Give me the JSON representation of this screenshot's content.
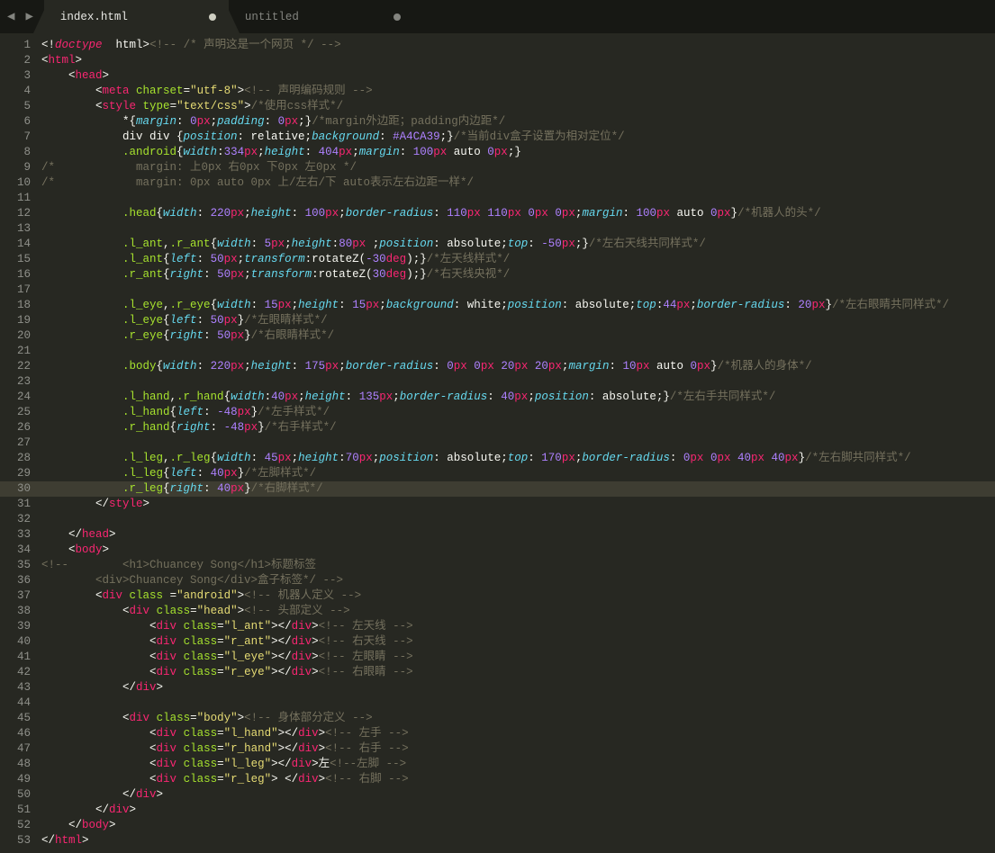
{
  "tabs": {
    "active": "index.html",
    "inactive": "untitled"
  },
  "gutter": [
    "1",
    "2",
    "3",
    "4",
    "5",
    "6",
    "7",
    "8",
    "9",
    "10",
    "11",
    "12",
    "13",
    "14",
    "15",
    "16",
    "17",
    "18",
    "19",
    "20",
    "21",
    "22",
    "23",
    "24",
    "25",
    "26",
    "27",
    "28",
    "29",
    "30",
    "31",
    "32",
    "33",
    "34",
    "35",
    "36",
    "37",
    "38",
    "39",
    "40",
    "41",
    "42",
    "43",
    "44",
    "45",
    "46",
    "47",
    "48",
    "49",
    "50",
    "51",
    "52",
    "53"
  ],
  "highlight_line_index": 29,
  "code": {
    "l1": {
      "a": "<!",
      "b": "doctype",
      "c": "  html",
      "d": ">",
      "e": "<!-- /* 声明这是一个网页 */ -->"
    },
    "l2": {
      "a": "<",
      "b": "html",
      "c": ">"
    },
    "l3": {
      "a": "    <",
      "b": "head",
      "c": ">"
    },
    "l4": {
      "a": "        <",
      "b": "meta",
      "c": " ",
      "d": "charset",
      "e": "=",
      "f": "\"utf-8\"",
      "g": ">",
      "h": "<!-- 声明编码规则 -->"
    },
    "l5": {
      "a": "        <",
      "b": "style",
      "c": " ",
      "d": "type",
      "e": "=",
      "f": "\"text/css\"",
      "g": ">",
      "h": "/*使用css样式*/"
    },
    "l6": {
      "a": "            *{",
      "b": "margin",
      "c": ": ",
      "d": "0",
      "e": "px",
      "f": ";",
      "g": "padding",
      "h": ": ",
      "i": "0",
      "j": "px",
      "k": ";}",
      "l": "/*margin外边距；padding内边距*/"
    },
    "l7": {
      "a": "            div div {",
      "b": "position",
      "c": ": relative;",
      "d": "background",
      "e": ": ",
      "f": "#A4CA39",
      "g": ";}",
      "h": "/*当前div盒子设置为相对定位*/"
    },
    "l8": {
      "a": "            ",
      "sel": ".android",
      "b": "{",
      "c": "width",
      "d": ":",
      "e": "334",
      "f": "px",
      "g": ";",
      "h": "height",
      "i": ": ",
      "j": "404",
      "k": "px",
      "l": ";",
      "m": "margin",
      "n": ": ",
      "o": "100",
      "p": "px",
      "q": " auto ",
      "r": "0",
      "s": "px",
      "t": ";}"
    },
    "l9": {
      "a": "/*            margin: 上0px 右0px 下0px 左0px */"
    },
    "l10": {
      "a": "/*            margin: 0px auto 0px 上/左右/下 auto表示左右边距一样*/"
    },
    "l11": "",
    "l12": {
      "a": "            ",
      "sel": ".head",
      "b": "{",
      "c": "width",
      "d": ": ",
      "e": "220",
      "f": "px",
      "g": ";",
      "h": "height",
      "i": ": ",
      "j": "100",
      "k": "px",
      "l": ";",
      "m": "border-radius",
      "n": ": ",
      "o": "110",
      "p": "px",
      "q": " ",
      "r": "110",
      "s": "px",
      "t": " ",
      "u": "0",
      "v": "px",
      "w": " ",
      "x": "0",
      "y": "px",
      "z": ";",
      "aa": "margin",
      "ab": ": ",
      "ac": "100",
      "ad": "px",
      "ae": " auto ",
      "af": "0",
      "ag": "px",
      "ah": "}",
      "ai": "/*机器人的头*/"
    },
    "l13": "",
    "l14": {
      "a": "            ",
      "sel": ".l_ant",
      "b": ",",
      "sel2": ".r_ant",
      "c": "{",
      "d": "width",
      "e": ": ",
      "f": "5",
      "g": "px",
      "h": ";",
      "i": "height",
      "j": ":",
      "k": "80",
      "l": "px",
      "m": " ;",
      "n": "position",
      "o": ": absolute;",
      "p": "top",
      "q": ": ",
      "r": "-50",
      "s": "px",
      "t": ";}",
      "u": "/*左右天线共同样式*/"
    },
    "l15": {
      "a": "            ",
      "sel": ".l_ant",
      "b": "{",
      "c": "left",
      "d": ": ",
      "e": "50",
      "f": "px",
      "g": ";",
      "h": "transform",
      "i": ":rotateZ(",
      "j": "-30",
      "k": "deg",
      "l": ");}",
      "m": "/*左天线样式*/"
    },
    "l16": {
      "a": "            ",
      "sel": ".r_ant",
      "b": "{",
      "c": "right",
      "d": ": ",
      "e": "50",
      "f": "px",
      "g": ";",
      "h": "transform",
      "i": ":rotateZ(",
      "j": "30",
      "k": "deg",
      "l": ");}",
      "m": "/*右天线央视*/"
    },
    "l17": "",
    "l18": {
      "a": "            ",
      "sel": ".l_eye",
      "b": ",",
      "sel2": ".r_eye",
      "c": "{",
      "d": "width",
      "e": ": ",
      "f": "15",
      "g": "px",
      "h": ";",
      "i": "height",
      "j": ": ",
      "k": "15",
      "l": "px",
      "m": ";",
      "n": "background",
      "o": ": white;",
      "p": "position",
      "q": ": absolute;",
      "r": "top",
      "s": ":",
      "t": "44",
      "u": "px",
      "v": ";",
      "w": "border-radius",
      "x": ": ",
      "y": "20",
      "z": "px",
      "aa": "}",
      "ab": "/*左右眼睛共同样式*/"
    },
    "l19": {
      "a": "            ",
      "sel": ".l_eye",
      "b": "{",
      "c": "left",
      "d": ": ",
      "e": "50",
      "f": "px",
      "g": "}",
      "h": "/*左眼睛样式*/"
    },
    "l20": {
      "a": "            ",
      "sel": ".r_eye",
      "b": "{",
      "c": "right",
      "d": ": ",
      "e": "50",
      "f": "px",
      "g": "}",
      "h": "/*右眼睛样式*/"
    },
    "l21": "",
    "l22": {
      "a": "            ",
      "sel": ".body",
      "b": "{",
      "c": "width",
      "d": ": ",
      "e": "220",
      "f": "px",
      "g": ";",
      "h": "height",
      "i": ": ",
      "j": "175",
      "k": "px",
      "l": ";",
      "m": "border-radius",
      "n": ": ",
      "o": "0",
      "p": "px",
      "q": " ",
      "r": "0",
      "s": "px",
      "t": " ",
      "u": "20",
      "v": "px",
      "w": " ",
      "x": "20",
      "y": "px",
      "z": ";",
      "aa": "margin",
      "ab": ": ",
      "ac": "10",
      "ad": "px",
      "ae": " auto ",
      "af": "0",
      "ag": "px",
      "ah": "}",
      "ai": "/*机器人的身体*/"
    },
    "l23": "",
    "l24": {
      "a": "            ",
      "sel": ".l_hand",
      "b": ",",
      "sel2": ".r_hand",
      "c": "{",
      "d": "width",
      "e": ":",
      "f": "40",
      "g": "px",
      "h": ";",
      "i": "height",
      "j": ": ",
      "k": "135",
      "l": "px",
      "m": ";",
      "n": "border-radius",
      "o": ": ",
      "p": "40",
      "q": "px",
      "r": ";",
      "s": "position",
      "t": ": absolute;}",
      "u": "/*左右手共同样式*/"
    },
    "l25": {
      "a": "            ",
      "sel": ".l_hand",
      "b": "{",
      "c": "left",
      "d": ": ",
      "e": "-48",
      "f": "px",
      "g": "}",
      "h": "/*左手样式*/"
    },
    "l26": {
      "a": "            ",
      "sel": ".r_hand",
      "b": "{",
      "c": "right",
      "d": ": ",
      "e": "-48",
      "f": "px",
      "g": "}",
      "h": "/*右手样式*/"
    },
    "l27": "",
    "l28": {
      "a": "            ",
      "sel": ".l_leg",
      "b": ",",
      "sel2": ".r_leg",
      "c": "{",
      "d": "width",
      "e": ": ",
      "f": "45",
      "g": "px",
      "h": ";",
      "i": "height",
      "j": ":",
      "k": "70",
      "l": "px",
      "m": ";",
      "n": "position",
      "o": ": absolute;",
      "p": "top",
      "q": ": ",
      "r": "170",
      "s": "px",
      "t": ";",
      "u": "border-radius",
      "v": ": ",
      "w": "0",
      "x": "px",
      "y": " ",
      "z": "0",
      "aa": "px",
      "ab": " ",
      "ac": "40",
      "ad": "px",
      "ae": " ",
      "af": "40",
      "ag": "px",
      "ah": "}",
      "ai": "/*左右脚共同样式*/"
    },
    "l29": {
      "a": "            ",
      "sel": ".l_leg",
      "b": "{",
      "c": "left",
      "d": ": ",
      "e": "40",
      "f": "px",
      "g": "}",
      "h": "/*左脚样式*/"
    },
    "l30": {
      "a": "            ",
      "sel": ".r_leg",
      "b": "{",
      "c": "right",
      "d": ": ",
      "e": "40",
      "f": "px",
      "g": "}",
      "h": "/*右脚样式*/"
    },
    "l31": {
      "a": "        </",
      "b": "style",
      "c": ">"
    },
    "l32": "",
    "l33": {
      "a": "    </",
      "b": "head",
      "c": ">"
    },
    "l34": {
      "a": "    <",
      "b": "body",
      "c": ">"
    },
    "l35": {
      "a": "<!--        <h1>Chuancey Song</h1>标题标签"
    },
    "l36": {
      "a": "        <div>Chuancey Song</div>盒子标签*/ -->"
    },
    "l37": {
      "a": "        <",
      "b": "div",
      "c": " ",
      "d": "class",
      "e": " =",
      "f": "\"android\"",
      "g": ">",
      "h": "<!-- 机器人定义 -->"
    },
    "l38": {
      "a": "            <",
      "b": "div",
      "c": " ",
      "d": "class",
      "e": "=",
      "f": "\"head\"",
      "g": ">",
      "h": "<!-- 头部定义 -->"
    },
    "l39": {
      "a": "                <",
      "b": "div",
      "c": " ",
      "d": "class",
      "e": "=",
      "f": "\"l_ant\"",
      "g": "></",
      "h": "div",
      "i": ">",
      "j": "<!-- 左天线 -->"
    },
    "l40": {
      "a": "                <",
      "b": "div",
      "c": " ",
      "d": "class",
      "e": "=",
      "f": "\"r_ant\"",
      "g": "></",
      "h": "div",
      "i": ">",
      "j": "<!-- 右天线 -->"
    },
    "l41": {
      "a": "                <",
      "b": "div",
      "c": " ",
      "d": "class",
      "e": "=",
      "f": "\"l_eye\"",
      "g": "></",
      "h": "div",
      "i": ">",
      "j": "<!-- 左眼睛 -->"
    },
    "l42": {
      "a": "                <",
      "b": "div",
      "c": " ",
      "d": "class",
      "e": "=",
      "f": "\"r_eye\"",
      "g": "></",
      "h": "div",
      "i": ">",
      "j": "<!-- 右眼睛 -->"
    },
    "l43": {
      "a": "            </",
      "b": "div",
      "c": ">"
    },
    "l44": "",
    "l45": {
      "a": "            <",
      "b": "div",
      "c": " ",
      "d": "class",
      "e": "=",
      "f": "\"body\"",
      "g": ">",
      "h": "<!-- 身体部分定义 -->"
    },
    "l46": {
      "a": "                <",
      "b": "div",
      "c": " ",
      "d": "class",
      "e": "=",
      "f": "\"l_hand\"",
      "g": "></",
      "h": "div",
      "i": ">",
      "j": "<!-- 左手 -->"
    },
    "l47": {
      "a": "                <",
      "b": "div",
      "c": " ",
      "d": "class",
      "e": "=",
      "f": "\"r_hand\"",
      "g": "></",
      "h": "div",
      "i": ">",
      "j": "<!-- 右手 -->"
    },
    "l48": {
      "a": "                <",
      "b": "div",
      "c": " ",
      "d": "class",
      "e": "=",
      "f": "\"l_leg\"",
      "g": "></",
      "h": "div",
      "i": ">左",
      "j": "<!--左脚 -->"
    },
    "l49": {
      "a": "                <",
      "b": "div",
      "c": " ",
      "d": "class",
      "e": "=",
      "f": "\"r_leg\"",
      "g": "> </",
      "h": "div",
      "i": ">",
      "j": "<!-- 右脚 -->"
    },
    "l50": {
      "a": "            </",
      "b": "div",
      "c": ">"
    },
    "l51": {
      "a": "        </",
      "b": "div",
      "c": ">"
    },
    "l52": {
      "a": "    </",
      "b": "body",
      "c": ">"
    },
    "l53": {
      "a": "</",
      "b": "html",
      "c": ">"
    }
  }
}
